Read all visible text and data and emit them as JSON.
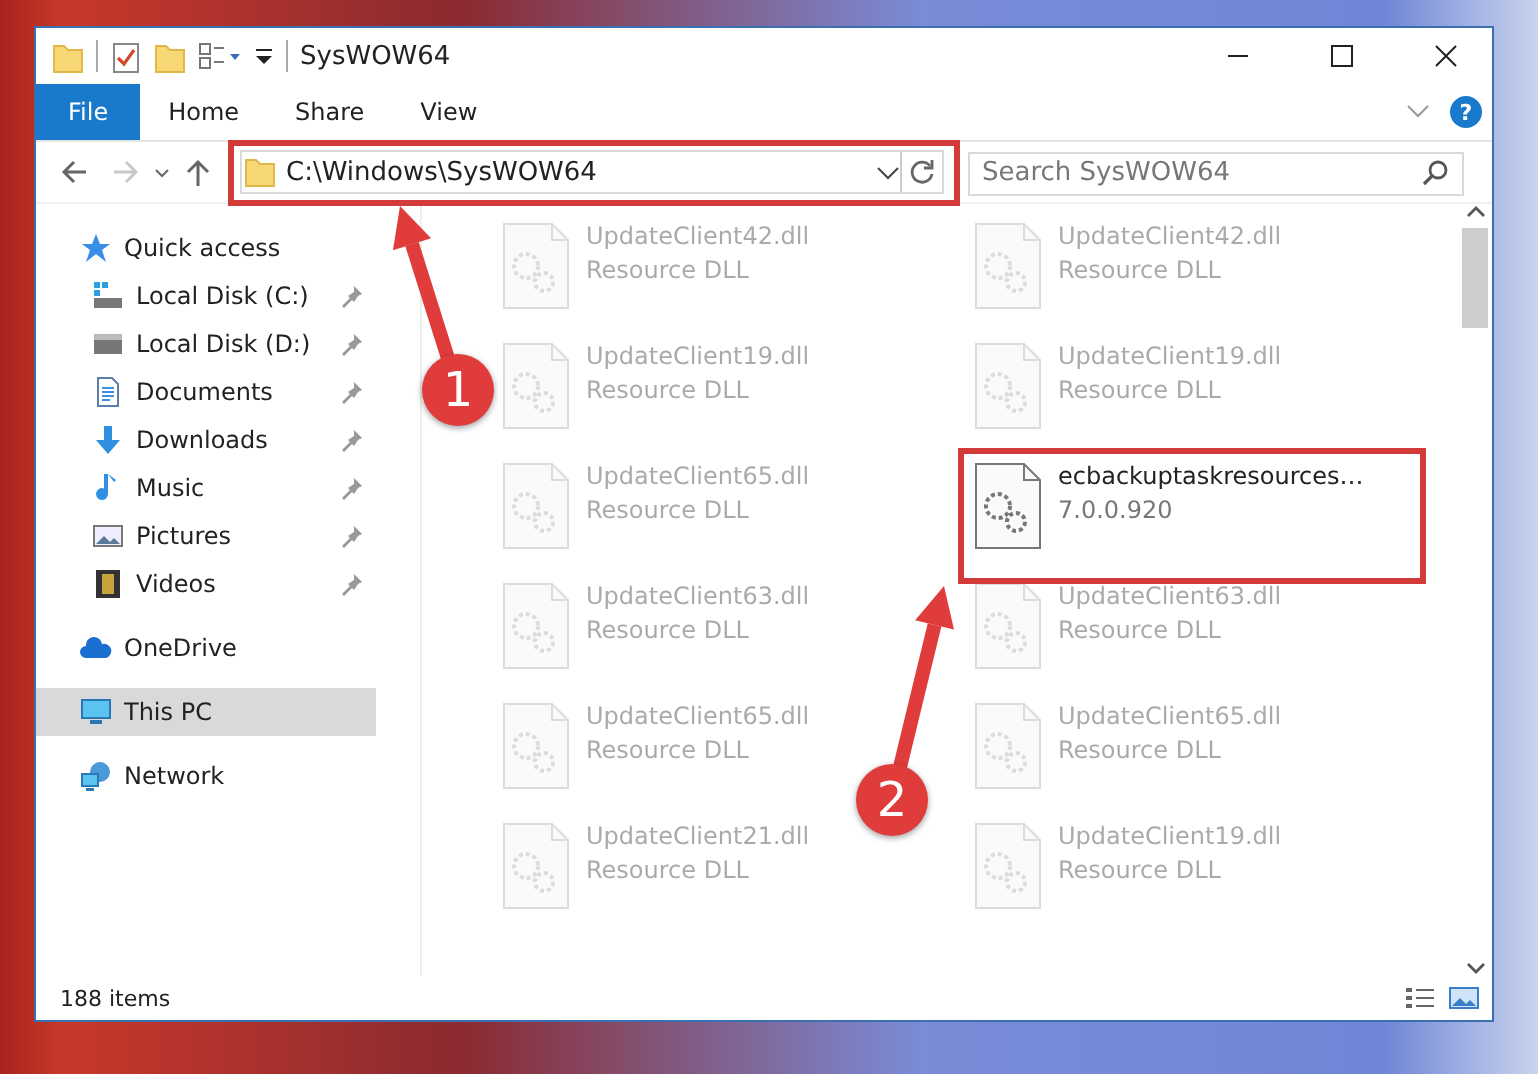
{
  "window": {
    "title": "SysWOW64"
  },
  "ribbon": {
    "tabs": [
      {
        "label": "File",
        "kind": "file"
      },
      {
        "label": "Home",
        "kind": "tab"
      },
      {
        "label": "Share",
        "kind": "tab"
      },
      {
        "label": "View",
        "kind": "tab"
      }
    ],
    "help": "?"
  },
  "navigation": {
    "forward_disabled": true
  },
  "address": {
    "path": "C:\\Windows\\SysWOW64"
  },
  "search": {
    "placeholder": "Search SysWOW64"
  },
  "sidebar": {
    "items": [
      {
        "label": "Quick access",
        "selected": false,
        "children": [
          {
            "label": "Local Disk (C:)",
            "pinned": true,
            "selected": false
          },
          {
            "label": "Local Disk (D:)",
            "pinned": true,
            "selected": false
          },
          {
            "label": "Documents",
            "pinned": true,
            "selected": false
          },
          {
            "label": "Downloads",
            "pinned": true,
            "selected": false
          },
          {
            "label": "Music",
            "pinned": true,
            "selected": false
          },
          {
            "label": "Pictures",
            "pinned": true,
            "selected": false
          },
          {
            "label": "Videos",
            "pinned": true,
            "selected": false
          }
        ]
      },
      {
        "label": "OneDrive",
        "selected": false
      },
      {
        "label": "This PC",
        "selected": true
      },
      {
        "label": "Network",
        "selected": false
      }
    ]
  },
  "files": [
    {
      "name": "UpdateClient42.dll",
      "detail": "Resource DLL",
      "kind": "dimmed"
    },
    {
      "name": "UpdateClient42.dll",
      "detail": "Resource DLL",
      "kind": "dimmed"
    },
    {
      "name": "UpdateClient19.dll",
      "detail": "Resource DLL",
      "kind": "dimmed"
    },
    {
      "name": "UpdateClient19.dll",
      "detail": "Resource DLL",
      "kind": "dimmed"
    },
    {
      "name": "UpdateClient65.dll",
      "detail": "Resource DLL",
      "kind": "dimmed"
    },
    {
      "name": "ecbackuptaskresources…",
      "detail": "7.0.0.920",
      "kind": "clear"
    },
    {
      "name": "UpdateClient63.dll",
      "detail": "Resource DLL",
      "kind": "dimmed"
    },
    {
      "name": "UpdateClient63.dll",
      "detail": "Resource DLL",
      "kind": "dimmed"
    },
    {
      "name": "UpdateClient65.dll",
      "detail": "Resource DLL",
      "kind": "dimmed"
    },
    {
      "name": "UpdateClient65.dll",
      "detail": "Resource DLL",
      "kind": "dimmed"
    },
    {
      "name": "UpdateClient21.dll",
      "detail": "Resource DLL",
      "kind": "dimmed"
    },
    {
      "name": "UpdateClient19.dll",
      "detail": "Resource DLL",
      "kind": "dimmed"
    }
  ],
  "status_bar": {
    "item_count": "188 items"
  },
  "annotations": [
    {
      "label": "1"
    },
    {
      "label": "2"
    }
  ]
}
